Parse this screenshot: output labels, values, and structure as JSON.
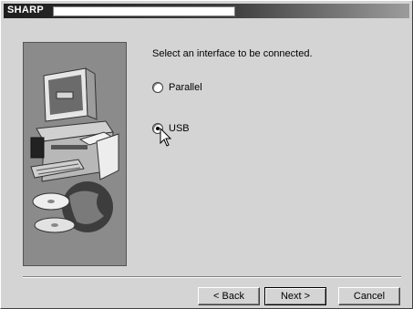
{
  "window": {
    "title": "SHARP"
  },
  "content": {
    "prompt": "Select an interface to be connected.",
    "options": [
      {
        "label": "Parallel",
        "selected": false
      },
      {
        "label": "USB",
        "selected": true
      }
    ]
  },
  "buttons": {
    "back": "< Back",
    "next": "Next >",
    "cancel": "Cancel"
  },
  "icons": {
    "illustration": "computer-printer-cd-globe-illustration",
    "cursor": "arrow-cursor-icon"
  }
}
